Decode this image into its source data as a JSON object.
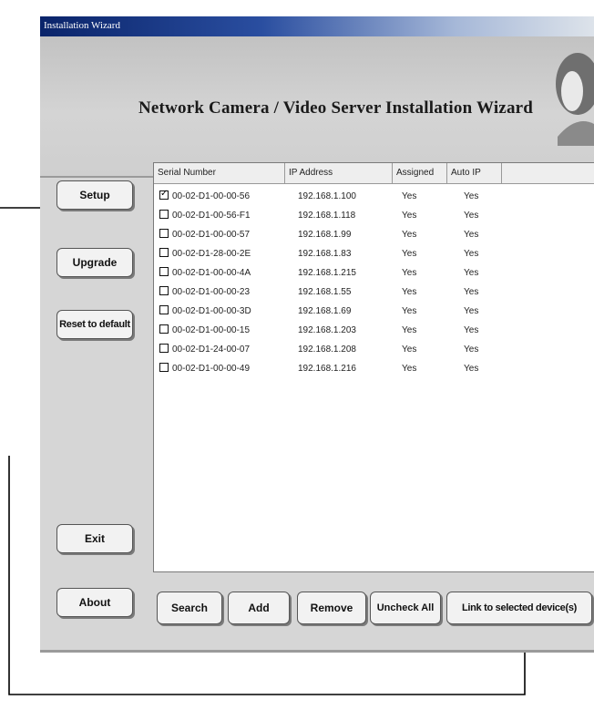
{
  "window": {
    "title": "Installation Wizard"
  },
  "banner": {
    "title": "Network Camera / Video Server Installation Wizard"
  },
  "sidebar": {
    "setup": "Setup",
    "upgrade": "Upgrade",
    "reset": "Reset to default",
    "exit": "Exit",
    "about": "About"
  },
  "table": {
    "columns": [
      "Serial Number",
      "IP Address",
      "Assigned",
      "Auto IP"
    ],
    "rows": [
      {
        "serial": "00-02-D1-00-00-56",
        "ip": "192.168.1.100",
        "assigned": "Yes",
        "auto_ip": "Yes",
        "checked": true
      },
      {
        "serial": "00-02-D1-00-56-F1",
        "ip": "192.168.1.118",
        "assigned": "Yes",
        "auto_ip": "Yes",
        "checked": false
      },
      {
        "serial": "00-02-D1-00-00-57",
        "ip": "192.168.1.99",
        "assigned": "Yes",
        "auto_ip": "Yes",
        "checked": false
      },
      {
        "serial": "00-02-D1-28-00-2E",
        "ip": "192.168.1.83",
        "assigned": "Yes",
        "auto_ip": "Yes",
        "checked": false
      },
      {
        "serial": "00-02-D1-00-00-4A",
        "ip": "192.168.1.215",
        "assigned": "Yes",
        "auto_ip": "Yes",
        "checked": false
      },
      {
        "serial": "00-02-D1-00-00-23",
        "ip": "192.168.1.55",
        "assigned": "Yes",
        "auto_ip": "Yes",
        "checked": false
      },
      {
        "serial": "00-02-D1-00-00-3D",
        "ip": "192.168.1.69",
        "assigned": "Yes",
        "auto_ip": "Yes",
        "checked": false
      },
      {
        "serial": "00-02-D1-00-00-15",
        "ip": "192.168.1.203",
        "assigned": "Yes",
        "auto_ip": "Yes",
        "checked": false
      },
      {
        "serial": "00-02-D1-24-00-07",
        "ip": "192.168.1.208",
        "assigned": "Yes",
        "auto_ip": "Yes",
        "checked": false
      },
      {
        "serial": "00-02-D1-00-00-49",
        "ip": "192.168.1.216",
        "assigned": "Yes",
        "auto_ip": "Yes",
        "checked": false
      }
    ]
  },
  "buttons": {
    "search": "Search",
    "add": "Add",
    "remove": "Remove",
    "uncheck_all": "Uncheck All",
    "link": "Link to selected device(s)"
  },
  "icons": {
    "arrow_right": "arrow-right-icon",
    "arrow_up": "arrow-up-icon",
    "checkbox": "checkbox-icon"
  }
}
